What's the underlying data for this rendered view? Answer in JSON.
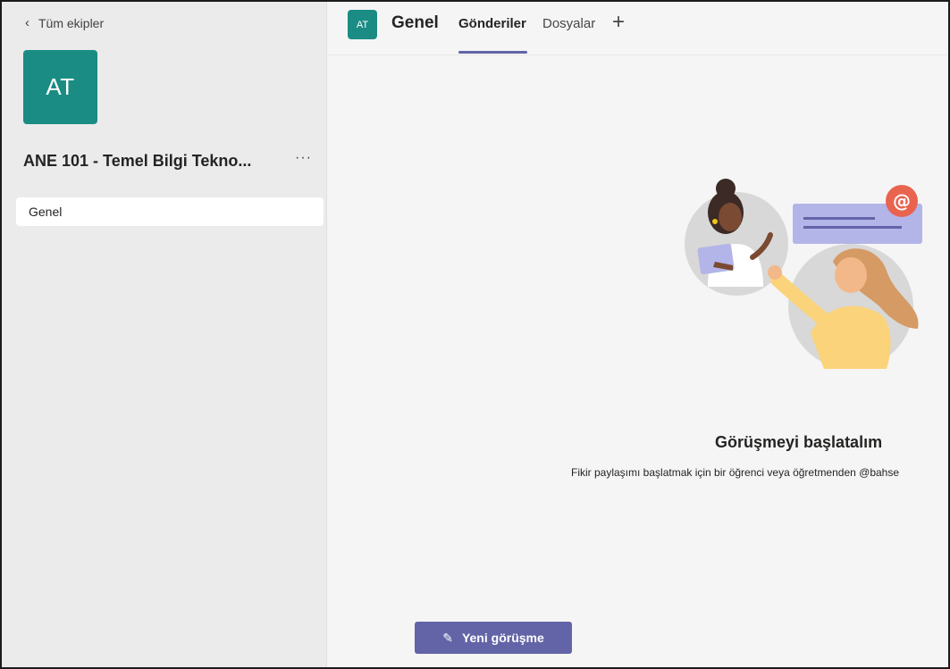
{
  "sidebar": {
    "back_label": "Tüm ekipler",
    "team_initials": "AT",
    "team_name": "ANE 101 - Temel Bilgi Tekno...",
    "more_label": "···",
    "channels": [
      {
        "label": "Genel",
        "selected": true
      }
    ]
  },
  "header": {
    "channel_initials": "AT",
    "channel_title": "Genel",
    "tabs": [
      {
        "label": "Gönderiler",
        "active": true
      },
      {
        "label": "Dosyalar",
        "active": false
      }
    ],
    "add_tab_icon": "plus-icon"
  },
  "main": {
    "empty_title": "Görüşmeyi başlatalım",
    "empty_subtitle": "Fikir paylaşımı başlatmak için bir öğrenci veya öğretmenden @bahse",
    "new_conversation_label": "Yeni görüşme",
    "new_conversation_icon": "compose-icon"
  },
  "colors": {
    "accent": "#6264a7",
    "team_avatar": "#1a8c84",
    "mention_badge": "#e9644f"
  }
}
